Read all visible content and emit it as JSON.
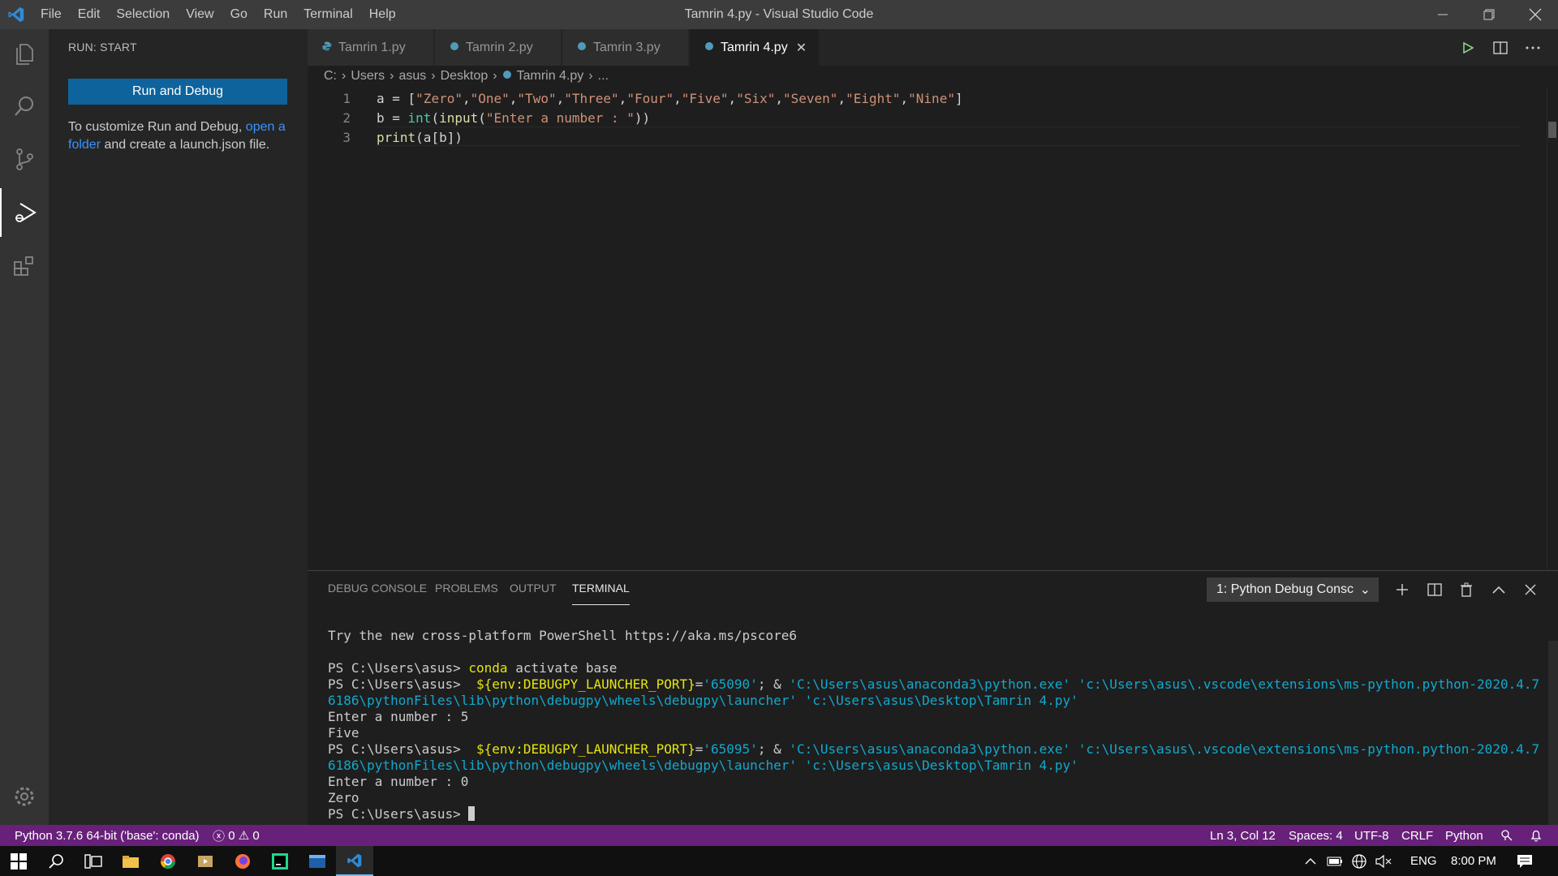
{
  "window": {
    "title": "Tamrin 4.py - Visual Studio Code",
    "menu": [
      "File",
      "Edit",
      "Selection",
      "View",
      "Go",
      "Run",
      "Terminal",
      "Help"
    ]
  },
  "sidebar": {
    "title": "RUN: START",
    "run_button": "Run and Debug",
    "desc_prefix": "To customize Run and Debug, ",
    "desc_link": "open a folder",
    "desc_suffix": " and create a launch.json file."
  },
  "tabs": [
    {
      "label": "Tamrin 1.py",
      "active": false
    },
    {
      "label": "Tamrin 2.py",
      "active": false
    },
    {
      "label": "Tamrin 3.py",
      "active": false
    },
    {
      "label": "Tamrin 4.py",
      "active": true
    }
  ],
  "breadcrumb": [
    "C:",
    "Users",
    "asus",
    "Desktop",
    "Tamrin 4.py",
    "..."
  ],
  "editor": {
    "line_numbers": [
      "1",
      "2",
      "3"
    ],
    "line1": {
      "a": "a = [",
      "s0": "\"Zero\"",
      "s1": "\"One\"",
      "s2": "\"Two\"",
      "s3": "\"Three\"",
      "s4": "\"Four\"",
      "s5": "\"Five\"",
      "s6": "\"Six\"",
      "s7": "\"Seven\"",
      "s8": "\"Eight\"",
      "s9": "\"Nine\"",
      "comma": ",",
      "end": "]"
    },
    "line2": {
      "a": "b = ",
      "int": "int",
      "p1": "(",
      "input": "input",
      "p2": "(",
      "str": "\"Enter a number : \"",
      "end": "))"
    },
    "line3": {
      "print": "print",
      "rest": "(a[b])"
    }
  },
  "panel": {
    "tabs": [
      "DEBUG CONSOLE",
      "PROBLEMS",
      "OUTPUT",
      "TERMINAL"
    ],
    "active_tab": "TERMINAL",
    "terminal_select": "1: Python Debug Consc",
    "terminal": {
      "line1": "Try the new cross-platform PowerShell https://aka.ms/pscore6",
      "prompt": "PS C:\\Users\\asus> ",
      "cmd1_a": "conda",
      "cmd1_b": " activate base",
      "env_var": " ${env:DEBUGPY_LAUNCHER_PORT}",
      "eq": "=",
      "port1": "'65090'",
      "port2": "'65095'",
      "amp": "; & ",
      "python_path": "'C:\\Users\\asus\\anaconda3\\python.exe'",
      "launcher_a": " 'c:\\Users\\asus\\.vscode\\extensions\\ms-python.python-2020.4.7",
      "launcher_b": "6186\\pythonFiles\\lib\\python\\debugpy\\wheels\\debugpy\\launcher'",
      "file_path": " 'c:\\Users\\asus\\Desktop\\Tamrin 4.py'",
      "input1": "Enter a number : 5",
      "out1": "Five",
      "input2": "Enter a number : 0",
      "out2": "Zero"
    }
  },
  "statusbar": {
    "interpreter": "Python 3.7.6 64-bit ('base': conda)",
    "errors": "0",
    "warnings": "0",
    "position": "Ln 3, Col 12",
    "spaces": "Spaces: 4",
    "encoding": "UTF-8",
    "eol": "CRLF",
    "language": "Python"
  },
  "taskbar": {
    "lang": "ENG",
    "time": "8:00 PM"
  },
  "colors": {
    "accent": "#0e639c",
    "statusbar": "#68217a",
    "link": "#3794ff"
  }
}
